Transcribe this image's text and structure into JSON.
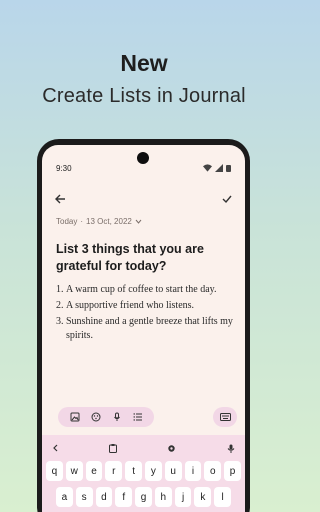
{
  "promo": {
    "headline": "New",
    "subline": "Create Lists in Journal"
  },
  "status_bar": {
    "time": "9:30"
  },
  "entry": {
    "date_prefix": "Today",
    "separator": "·",
    "date": "13 Oct, 2022",
    "prompt": "List 3 things that you are grateful for today?",
    "items": [
      {
        "num": "1.",
        "text": "A warm cup of coffee to start the day."
      },
      {
        "num": "2.",
        "text": "A supportive friend who listens."
      },
      {
        "num": "3.",
        "text": "Sunshine and a gentle breeze that lifts my spirits."
      }
    ]
  },
  "icons": {
    "back": "back-arrow-icon",
    "done": "check-icon",
    "toolbar": [
      "image-icon",
      "palette-icon",
      "mic-icon",
      "list-icon"
    ],
    "keyboard_toggle": "keyboard-icon"
  },
  "keyboard": {
    "row1": [
      "q",
      "w",
      "e",
      "r",
      "t",
      "y",
      "u",
      "i",
      "o",
      "p"
    ],
    "row2": [
      "a",
      "s",
      "d",
      "f",
      "g",
      "h",
      "j",
      "k",
      "l"
    ]
  },
  "colors": {
    "screen_bg": "#fbf1ec",
    "accent_pink": "#f2d7e6",
    "keyboard_bg": "#f6dce8"
  }
}
